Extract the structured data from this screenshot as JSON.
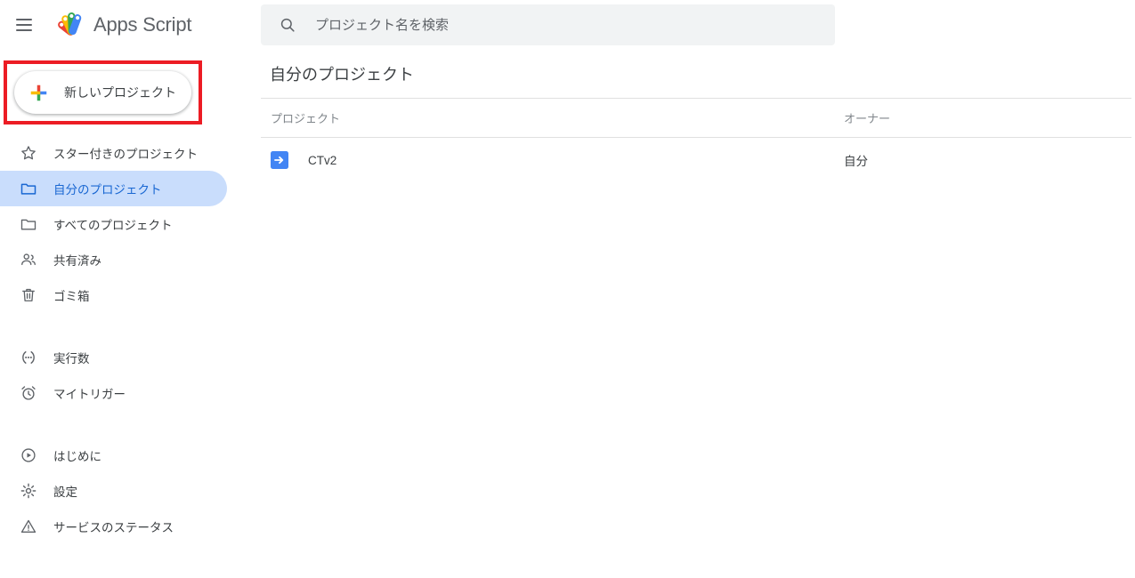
{
  "app": {
    "title": "Apps Script",
    "menu_icon": "hamburger-menu-icon",
    "logo_icon": "apps-script-logo-icon"
  },
  "sidebar": {
    "new_project": {
      "label": "新しいプロジェクト",
      "icon": "google-plus-icon",
      "highlight_color": "#ec1c24"
    },
    "items": [
      {
        "label": "スター付きのプロジェクト",
        "icon": "star-icon",
        "selected": false
      },
      {
        "label": "自分のプロジェクト",
        "icon": "folder-filled-icon",
        "selected": true
      },
      {
        "label": "すべてのプロジェクト",
        "icon": "folder-icon",
        "selected": false
      },
      {
        "label": "共有済み",
        "icon": "people-icon",
        "selected": false
      },
      {
        "label": "ゴミ箱",
        "icon": "trash-icon",
        "selected": false
      },
      {
        "label": "実行数",
        "icon": "executions-icon",
        "selected": false
      },
      {
        "label": "マイトリガー",
        "icon": "alarm-clock-icon",
        "selected": false
      },
      {
        "label": "はじめに",
        "icon": "play-circle-icon",
        "selected": false
      },
      {
        "label": "設定",
        "icon": "gear-icon",
        "selected": false
      },
      {
        "label": "サービスのステータス",
        "icon": "warning-triangle-icon",
        "selected": false
      }
    ],
    "selected_color": "#1967d2",
    "selected_bg": "#c9ddfc"
  },
  "search": {
    "placeholder": "プロジェクト名を検索",
    "value": "",
    "icon": "search-icon"
  },
  "main": {
    "page_title": "自分のプロジェクト",
    "table": {
      "columns": [
        "プロジェクト",
        "オーナー"
      ],
      "rows": [
        {
          "name": "CTv2",
          "owner": "自分",
          "icon": "project-arrow-icon",
          "icon_color": "#4285f4"
        }
      ]
    }
  }
}
